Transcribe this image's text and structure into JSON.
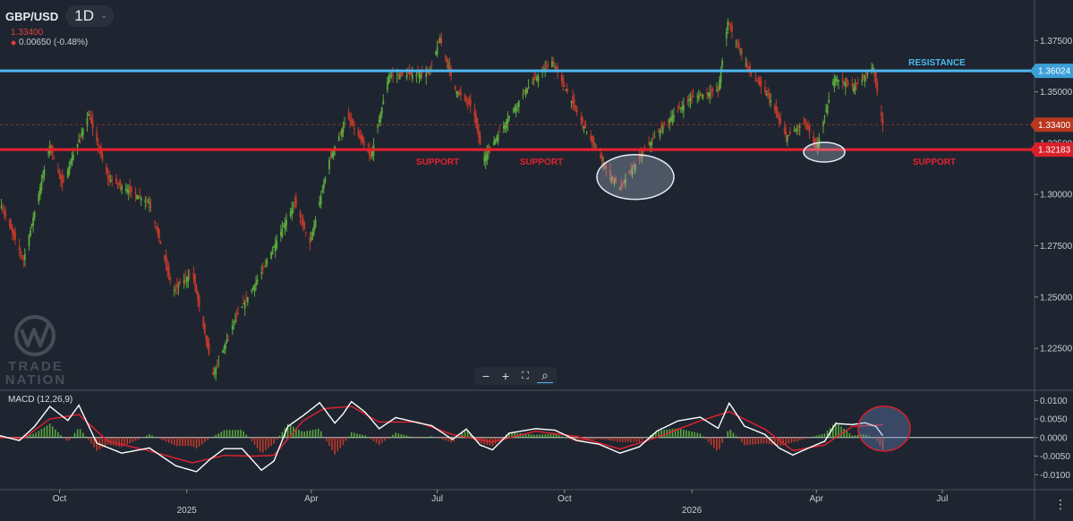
{
  "header": {
    "symbol": "GBP/USD",
    "timeframe": "1D",
    "price": "1.33400",
    "change": "0.00650 (-0.48%)"
  },
  "watermark": {
    "brand_line1": "TRADE",
    "brand_line2": "NATION"
  },
  "toolbar": {
    "zoom_out": "−",
    "zoom_in": "+",
    "fit": "⛶",
    "magnifier": "⌕"
  },
  "colors": {
    "background": "#1e2530",
    "resistance": "#4db8f0",
    "support": "#e8202e",
    "up": "#5aa83c",
    "down": "#c0392b",
    "macd": "#ffffff",
    "signal": "#e8202e"
  },
  "chart_data": [
    {
      "type": "candlestick",
      "title": "GBP/USD",
      "timeframe": "1D",
      "x_ticks": [
        "Oct",
        "2025",
        "Apr",
        "Jul",
        "Oct",
        "2026",
        "Apr",
        "Jul"
      ],
      "y_ticks": [
        "1.37500",
        "1.35000",
        "1.32500",
        "1.30000",
        "1.27500",
        "1.25000",
        "1.22500"
      ],
      "ylim": [
        1.205,
        1.393
      ],
      "horizontal_levels": [
        {
          "label": "RESISTANCE",
          "value": 1.36024,
          "tag": "1.36024",
          "color": "#4db8f0"
        },
        {
          "label": "SUPPORT",
          "value": 1.32183,
          "tag": "1.32183",
          "color": "#e8202e"
        }
      ],
      "current_price": {
        "value": 1.334,
        "tag": "1.33400"
      },
      "support_labels": [
        "SUPPORT",
        "SUPPORT",
        "SUPPORT"
      ],
      "price_path": [
        [
          "2024-08-19",
          1.296
        ],
        [
          "2024-09-05",
          1.268
        ],
        [
          "2024-09-24",
          1.324
        ],
        [
          "2024-10-03",
          1.305
        ],
        [
          "2024-10-22",
          1.339
        ],
        [
          "2024-11-05",
          1.308
        ],
        [
          "2024-12-05",
          1.296
        ],
        [
          "2024-12-22",
          1.253
        ],
        [
          "2025-01-05",
          1.262
        ],
        [
          "2025-01-20",
          1.212
        ],
        [
          "2025-02-04",
          1.238
        ],
        [
          "2025-02-24",
          1.262
        ],
        [
          "2025-03-20",
          1.296
        ],
        [
          "2025-03-31",
          1.276
        ],
        [
          "2025-04-14",
          1.317
        ],
        [
          "2025-04-27",
          1.338
        ],
        [
          "2025-05-14",
          1.318
        ],
        [
          "2025-05-27",
          1.358
        ],
        [
          "2025-06-25",
          1.359
        ],
        [
          "2025-07-03",
          1.376
        ],
        [
          "2025-07-14",
          1.351
        ],
        [
          "2025-07-27",
          1.342
        ],
        [
          "2025-08-03",
          1.317
        ],
        [
          "2025-08-22",
          1.338
        ],
        [
          "2025-09-03",
          1.351
        ],
        [
          "2025-09-22",
          1.365
        ],
        [
          "2025-10-10",
          1.34
        ],
        [
          "2025-11-01",
          1.311
        ],
        [
          "2025-11-10",
          1.303
        ],
        [
          "2025-11-27",
          1.321
        ],
        [
          "2025-12-12",
          1.334
        ],
        [
          "2025-12-31",
          1.347
        ],
        [
          "2026-01-20",
          1.351
        ],
        [
          "2026-01-27",
          1.384
        ],
        [
          "2026-02-10",
          1.362
        ],
        [
          "2026-02-27",
          1.346
        ],
        [
          "2026-03-10",
          1.328
        ],
        [
          "2026-03-24",
          1.335
        ],
        [
          "2026-04-01",
          1.322
        ],
        [
          "2026-04-14",
          1.357
        ],
        [
          "2026-04-28",
          1.352
        ],
        [
          "2026-05-12",
          1.362
        ],
        [
          "2026-05-19",
          1.334
        ]
      ]
    },
    {
      "type": "line",
      "title": "MACD (12,26,9)",
      "y_ticks": [
        "0.0100",
        "0.0050",
        "0.0000",
        "-0.0050",
        "-0.0100"
      ],
      "ylim": [
        -0.0138,
        0.0125
      ],
      "series": [
        {
          "name": "MACD",
          "points": [
            [
              "2024-08-19",
              0.0005
            ],
            [
              "2024-09-02",
              -0.0008
            ],
            [
              "2024-09-13",
              0.003
            ],
            [
              "2024-09-24",
              0.0084
            ],
            [
              "2024-10-07",
              0.0046
            ],
            [
              "2024-10-15",
              0.0087
            ],
            [
              "2024-10-28",
              -0.0015
            ],
            [
              "2024-11-15",
              -0.0042
            ],
            [
              "2024-12-05",
              -0.0028
            ],
            [
              "2024-12-24",
              -0.0076
            ],
            [
              "2025-01-08",
              -0.0092
            ],
            [
              "2025-01-18",
              -0.0058
            ],
            [
              "2025-01-28",
              -0.003
            ],
            [
              "2025-02-10",
              -0.003
            ],
            [
              "2025-02-24",
              -0.0088
            ],
            [
              "2025-03-05",
              -0.0063
            ],
            [
              "2025-03-15",
              0.003
            ],
            [
              "2025-03-26",
              0.0059
            ],
            [
              "2025-04-07",
              0.0094
            ],
            [
              "2025-04-18",
              0.0039
            ],
            [
              "2025-04-24",
              0.0064
            ],
            [
              "2025-04-30",
              0.0097
            ],
            [
              "2025-05-10",
              0.0068
            ],
            [
              "2025-05-20",
              0.0024
            ],
            [
              "2025-06-01",
              0.0054
            ],
            [
              "2025-06-17",
              0.004
            ],
            [
              "2025-06-27",
              0.0032
            ],
            [
              "2025-07-12",
              -0.0005
            ],
            [
              "2025-07-22",
              0.0023
            ],
            [
              "2025-08-01",
              -0.002
            ],
            [
              "2025-08-10",
              -0.0033
            ],
            [
              "2025-08-22",
              0.0012
            ],
            [
              "2025-09-10",
              0.0024
            ],
            [
              "2025-09-24",
              0.002
            ],
            [
              "2025-10-10",
              -0.0008
            ],
            [
              "2025-10-26",
              -0.0018
            ],
            [
              "2025-11-10",
              -0.0042
            ],
            [
              "2025-11-24",
              -0.0025
            ],
            [
              "2025-12-07",
              0.0018
            ],
            [
              "2025-12-22",
              0.0045
            ],
            [
              "2026-01-07",
              0.0055
            ],
            [
              "2026-01-20",
              0.0025
            ],
            [
              "2026-01-28",
              0.0093
            ],
            [
              "2026-02-08",
              0.0031
            ],
            [
              "2026-02-23",
              0.0008
            ],
            [
              "2026-03-05",
              -0.0028
            ],
            [
              "2026-03-15",
              -0.0047
            ],
            [
              "2026-03-27",
              -0.0027
            ],
            [
              "2026-04-07",
              -0.001
            ],
            [
              "2026-04-15",
              0.0038
            ],
            [
              "2026-04-27",
              0.0035
            ],
            [
              "2026-05-06",
              0.004
            ],
            [
              "2026-05-14",
              0.003
            ],
            [
              "2026-05-19",
              0.0005
            ]
          ]
        },
        {
          "name": "Signal",
          "points": [
            [
              "2024-08-19",
              0.0
            ],
            [
              "2024-09-05",
              -0.0002
            ],
            [
              "2024-09-24",
              0.005
            ],
            [
              "2024-10-15",
              0.0062
            ],
            [
              "2024-11-05",
              -0.001
            ],
            [
              "2024-12-05",
              -0.0036
            ],
            [
              "2025-01-05",
              -0.0068
            ],
            [
              "2025-01-28",
              -0.0048
            ],
            [
              "2025-02-17",
              -0.005
            ],
            [
              "2025-03-05",
              -0.0048
            ],
            [
              "2025-03-26",
              0.0045
            ],
            [
              "2025-04-10",
              0.0078
            ],
            [
              "2025-04-30",
              0.0084
            ],
            [
              "2025-05-20",
              0.0042
            ],
            [
              "2025-06-17",
              0.0042
            ],
            [
              "2025-07-12",
              0.0008
            ],
            [
              "2025-08-10",
              -0.0012
            ],
            [
              "2025-09-10",
              0.0017
            ],
            [
              "2025-10-10",
              0.0003
            ],
            [
              "2025-11-10",
              -0.0031
            ],
            [
              "2025-12-07",
              0.0001
            ],
            [
              "2026-01-07",
              0.0045
            ],
            [
              "2026-01-28",
              0.007
            ],
            [
              "2026-02-23",
              0.0022
            ],
            [
              "2026-03-15",
              -0.0035
            ],
            [
              "2026-04-07",
              -0.002
            ],
            [
              "2026-04-27",
              0.003
            ],
            [
              "2026-05-19",
              0.0034
            ]
          ]
        }
      ]
    }
  ]
}
